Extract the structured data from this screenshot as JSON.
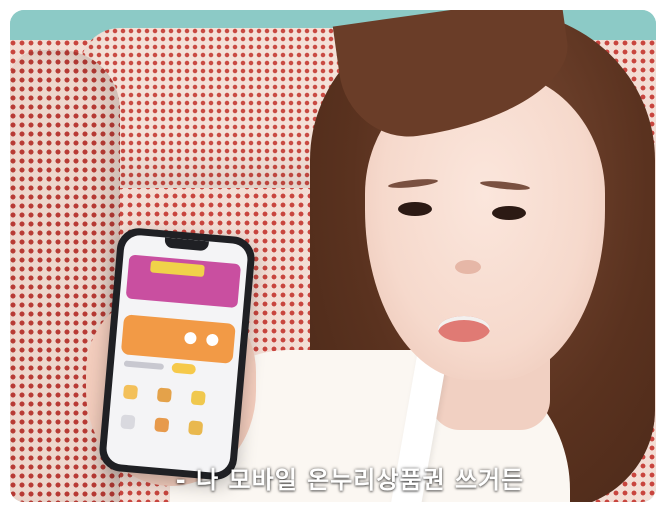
{
  "scene": {
    "phone_brand_icons": [
      "store-icon",
      "coupon-icon",
      "gift-icon"
    ],
    "colors": {
      "sofa_pattern": "#c8453e",
      "wall": "#8ccac6",
      "banner": "#c94fa0",
      "card": "#f29a46"
    }
  },
  "subtitle": {
    "text": "- 나 모바일 온누리상품권 쓰거든"
  }
}
